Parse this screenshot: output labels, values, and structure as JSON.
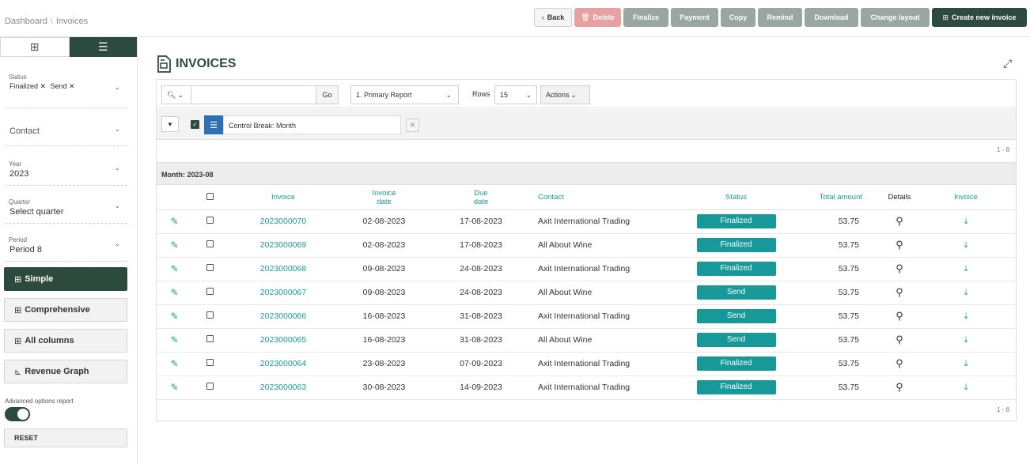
{
  "breadcrumb": {
    "root": "Dashboard",
    "sep": "\\",
    "current": "Invoices"
  },
  "toolbar": {
    "back": "Back",
    "delete": "Delete",
    "finalize": "Finalize",
    "payment": "Payment",
    "copy": "Copy",
    "remind": "Remind",
    "download": "Download",
    "change_layout": "Change layout",
    "create": "Create new invoice"
  },
  "sidebar": {
    "filters": {
      "status": {
        "label": "Status",
        "chips": [
          "Finalized",
          "Send"
        ]
      },
      "contact": {
        "value": "Contact"
      },
      "year": {
        "label": "Year",
        "value": "2023"
      },
      "quarter": {
        "label": "Quarter",
        "value": "Select quarter"
      },
      "period": {
        "label": "Period",
        "value": "Period 8"
      }
    },
    "reports": [
      "Simple",
      "Comprehensive",
      "All columns",
      "Revenue Graph"
    ],
    "advanced_label": "Advanced options report",
    "reset": "RESET"
  },
  "page_title": "INVOICES",
  "search": {
    "go": "Go",
    "report": "1. Primary Report",
    "rows_label": "Rows",
    "rows_value": "15",
    "actions": "Actions"
  },
  "control_break": {
    "label": "Control Break: Month"
  },
  "range": "1 - 8",
  "group": {
    "label": "Month: 2023-08"
  },
  "columns": {
    "invoice": "Invoice",
    "invoice_date_1": "Invoice",
    "invoice_date_2": "date",
    "due_date_1": "Due",
    "due_date_2": "date",
    "contact": "Contact",
    "status": "Status",
    "total": "Total amount",
    "details": "Details",
    "invoice_dl": "Invoice"
  },
  "rows": [
    {
      "invoice": "2023000070",
      "date": "02-08-2023",
      "due": "17-08-2023",
      "contact": "Axit International Trading",
      "status": "Finalized",
      "total": "53.75"
    },
    {
      "invoice": "2023000069",
      "date": "02-08-2023",
      "due": "17-08-2023",
      "contact": "All About Wine",
      "status": "Finalized",
      "total": "53.75"
    },
    {
      "invoice": "2023000068",
      "date": "09-08-2023",
      "due": "24-08-2023",
      "contact": "Axit International Trading",
      "status": "Finalized",
      "total": "53.75"
    },
    {
      "invoice": "2023000067",
      "date": "09-08-2023",
      "due": "24-08-2023",
      "contact": "All About Wine",
      "status": "Send",
      "total": "53.75"
    },
    {
      "invoice": "2023000066",
      "date": "16-08-2023",
      "due": "31-08-2023",
      "contact": "Axit International Trading",
      "status": "Send",
      "total": "53.75"
    },
    {
      "invoice": "2023000065",
      "date": "16-08-2023",
      "due": "31-08-2023",
      "contact": "All About Wine",
      "status": "Send",
      "total": "53.75"
    },
    {
      "invoice": "2023000064",
      "date": "23-08-2023",
      "due": "07-09-2023",
      "contact": "Axit International Trading",
      "status": "Finalized",
      "total": "53.75"
    },
    {
      "invoice": "2023000063",
      "date": "30-08-2023",
      "due": "14-09-2023",
      "contact": "Axit International Trading",
      "status": "Finalized",
      "total": "53.75"
    }
  ],
  "colors": {
    "brand": "#2d4a3e",
    "accent": "#1a9c8e",
    "badge": "#17999a"
  }
}
